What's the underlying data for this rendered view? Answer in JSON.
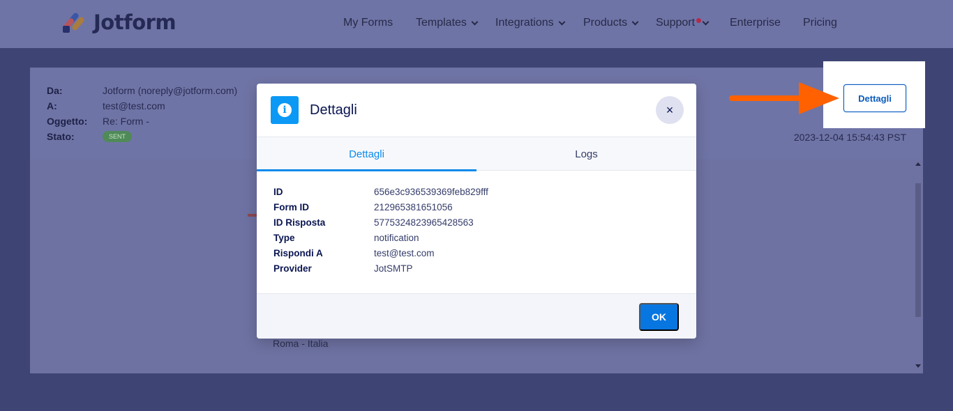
{
  "brand": {
    "name": "Jotform"
  },
  "nav": {
    "items": [
      {
        "label": "My Forms"
      },
      {
        "label": "Templates"
      },
      {
        "label": "Integrations"
      },
      {
        "label": "Products"
      },
      {
        "label": "Support"
      },
      {
        "label": "Enterprise"
      },
      {
        "label": "Pricing"
      }
    ]
  },
  "email": {
    "from_label": "Da:",
    "from_value": "Jotform (noreply@jotform.com)",
    "to_label": "A:",
    "to_value": "test@test.com",
    "subject_label": "Oggetto:",
    "subject_value": "Re: Form -",
    "status_label": "Stato:",
    "status_badge": "SENT",
    "date": "2023-12-04 15:54:43 PST",
    "address_text": "Roma - Italia",
    "details_button": "Dettagli"
  },
  "modal": {
    "title": "Dettagli",
    "close_symbol": "×",
    "tabs": [
      {
        "label": "Dettagli",
        "active": true
      },
      {
        "label": "Logs",
        "active": false
      }
    ],
    "details": [
      {
        "label": "ID",
        "value": "656e3c936539369feb829fff"
      },
      {
        "label": "Form ID",
        "value": "212965381651056"
      },
      {
        "label": "ID Risposta",
        "value": "5775324823965428563"
      },
      {
        "label": "Type",
        "value": "notification"
      },
      {
        "label": "Rispondi A",
        "value": "test@test.com"
      },
      {
        "label": "Provider",
        "value": "JotSMTP"
      }
    ],
    "ok_label": "OK"
  },
  "colors": {
    "accent": "#0876e0",
    "arrow": "#ff6100",
    "overlay_bg": "#3e4574"
  }
}
